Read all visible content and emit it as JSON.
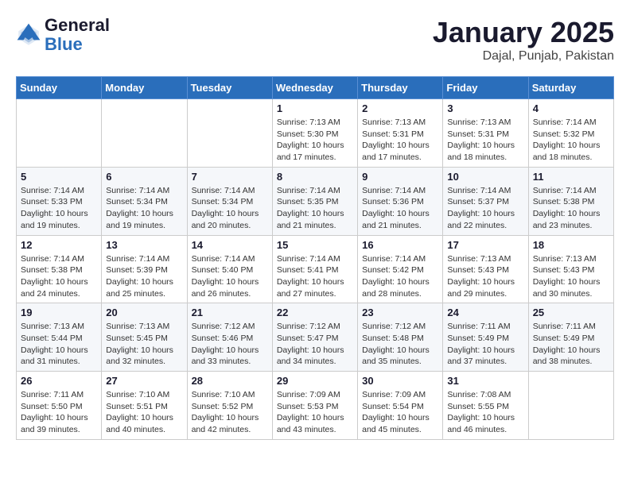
{
  "header": {
    "logo_general": "General",
    "logo_blue": "Blue",
    "month_title": "January 2025",
    "location": "Dajal, Punjab, Pakistan"
  },
  "days_of_week": [
    "Sunday",
    "Monday",
    "Tuesday",
    "Wednesday",
    "Thursday",
    "Friday",
    "Saturday"
  ],
  "weeks": [
    [
      {
        "day": "",
        "info": ""
      },
      {
        "day": "",
        "info": ""
      },
      {
        "day": "",
        "info": ""
      },
      {
        "day": "1",
        "info": "Sunrise: 7:13 AM\nSunset: 5:30 PM\nDaylight: 10 hours\nand 17 minutes."
      },
      {
        "day": "2",
        "info": "Sunrise: 7:13 AM\nSunset: 5:31 PM\nDaylight: 10 hours\nand 17 minutes."
      },
      {
        "day": "3",
        "info": "Sunrise: 7:13 AM\nSunset: 5:31 PM\nDaylight: 10 hours\nand 18 minutes."
      },
      {
        "day": "4",
        "info": "Sunrise: 7:14 AM\nSunset: 5:32 PM\nDaylight: 10 hours\nand 18 minutes."
      }
    ],
    [
      {
        "day": "5",
        "info": "Sunrise: 7:14 AM\nSunset: 5:33 PM\nDaylight: 10 hours\nand 19 minutes."
      },
      {
        "day": "6",
        "info": "Sunrise: 7:14 AM\nSunset: 5:34 PM\nDaylight: 10 hours\nand 19 minutes."
      },
      {
        "day": "7",
        "info": "Sunrise: 7:14 AM\nSunset: 5:34 PM\nDaylight: 10 hours\nand 20 minutes."
      },
      {
        "day": "8",
        "info": "Sunrise: 7:14 AM\nSunset: 5:35 PM\nDaylight: 10 hours\nand 21 minutes."
      },
      {
        "day": "9",
        "info": "Sunrise: 7:14 AM\nSunset: 5:36 PM\nDaylight: 10 hours\nand 21 minutes."
      },
      {
        "day": "10",
        "info": "Sunrise: 7:14 AM\nSunset: 5:37 PM\nDaylight: 10 hours\nand 22 minutes."
      },
      {
        "day": "11",
        "info": "Sunrise: 7:14 AM\nSunset: 5:38 PM\nDaylight: 10 hours\nand 23 minutes."
      }
    ],
    [
      {
        "day": "12",
        "info": "Sunrise: 7:14 AM\nSunset: 5:38 PM\nDaylight: 10 hours\nand 24 minutes."
      },
      {
        "day": "13",
        "info": "Sunrise: 7:14 AM\nSunset: 5:39 PM\nDaylight: 10 hours\nand 25 minutes."
      },
      {
        "day": "14",
        "info": "Sunrise: 7:14 AM\nSunset: 5:40 PM\nDaylight: 10 hours\nand 26 minutes."
      },
      {
        "day": "15",
        "info": "Sunrise: 7:14 AM\nSunset: 5:41 PM\nDaylight: 10 hours\nand 27 minutes."
      },
      {
        "day": "16",
        "info": "Sunrise: 7:14 AM\nSunset: 5:42 PM\nDaylight: 10 hours\nand 28 minutes."
      },
      {
        "day": "17",
        "info": "Sunrise: 7:13 AM\nSunset: 5:43 PM\nDaylight: 10 hours\nand 29 minutes."
      },
      {
        "day": "18",
        "info": "Sunrise: 7:13 AM\nSunset: 5:43 PM\nDaylight: 10 hours\nand 30 minutes."
      }
    ],
    [
      {
        "day": "19",
        "info": "Sunrise: 7:13 AM\nSunset: 5:44 PM\nDaylight: 10 hours\nand 31 minutes."
      },
      {
        "day": "20",
        "info": "Sunrise: 7:13 AM\nSunset: 5:45 PM\nDaylight: 10 hours\nand 32 minutes."
      },
      {
        "day": "21",
        "info": "Sunrise: 7:12 AM\nSunset: 5:46 PM\nDaylight: 10 hours\nand 33 minutes."
      },
      {
        "day": "22",
        "info": "Sunrise: 7:12 AM\nSunset: 5:47 PM\nDaylight: 10 hours\nand 34 minutes."
      },
      {
        "day": "23",
        "info": "Sunrise: 7:12 AM\nSunset: 5:48 PM\nDaylight: 10 hours\nand 35 minutes."
      },
      {
        "day": "24",
        "info": "Sunrise: 7:11 AM\nSunset: 5:49 PM\nDaylight: 10 hours\nand 37 minutes."
      },
      {
        "day": "25",
        "info": "Sunrise: 7:11 AM\nSunset: 5:49 PM\nDaylight: 10 hours\nand 38 minutes."
      }
    ],
    [
      {
        "day": "26",
        "info": "Sunrise: 7:11 AM\nSunset: 5:50 PM\nDaylight: 10 hours\nand 39 minutes."
      },
      {
        "day": "27",
        "info": "Sunrise: 7:10 AM\nSunset: 5:51 PM\nDaylight: 10 hours\nand 40 minutes."
      },
      {
        "day": "28",
        "info": "Sunrise: 7:10 AM\nSunset: 5:52 PM\nDaylight: 10 hours\nand 42 minutes."
      },
      {
        "day": "29",
        "info": "Sunrise: 7:09 AM\nSunset: 5:53 PM\nDaylight: 10 hours\nand 43 minutes."
      },
      {
        "day": "30",
        "info": "Sunrise: 7:09 AM\nSunset: 5:54 PM\nDaylight: 10 hours\nand 45 minutes."
      },
      {
        "day": "31",
        "info": "Sunrise: 7:08 AM\nSunset: 5:55 PM\nDaylight: 10 hours\nand 46 minutes."
      },
      {
        "day": "",
        "info": ""
      }
    ]
  ]
}
